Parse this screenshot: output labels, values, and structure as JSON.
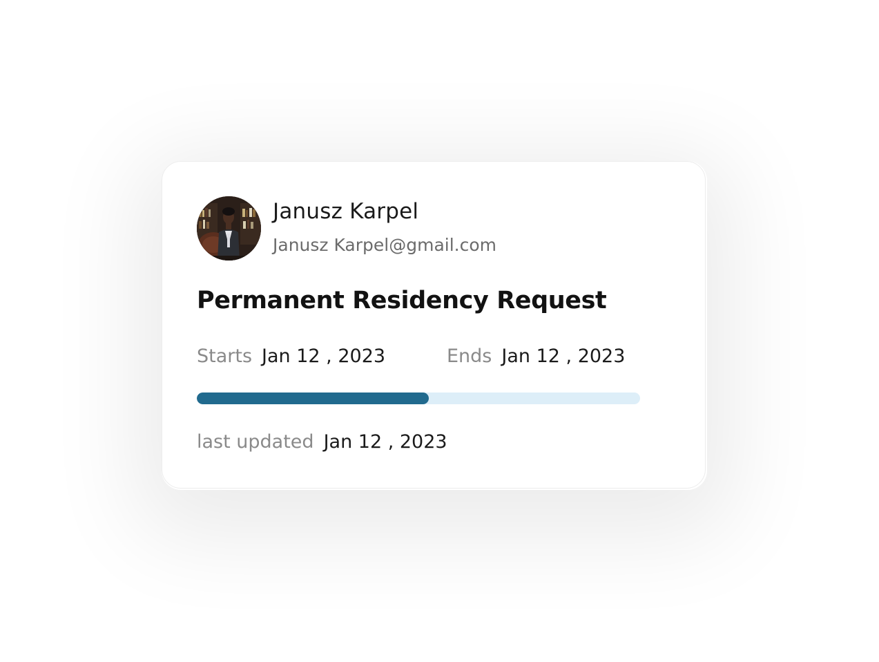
{
  "user": {
    "name": "Janusz Karpel",
    "email": "Janusz Karpel@gmail.com",
    "avatar_icon": "person-photo"
  },
  "request": {
    "title": "Permanent Residency Request",
    "starts_label": "Starts",
    "starts_value": "Jan 12 , 2023",
    "ends_label": "Ends",
    "ends_value": "Jan 12 , 2023",
    "progress": 0.523,
    "last_updated_label": "last updated",
    "last_updated_value": "Jan 12 , 2023"
  },
  "colors": {
    "progress_fill": "#216a8e",
    "progress_track": "#ddeef8"
  }
}
